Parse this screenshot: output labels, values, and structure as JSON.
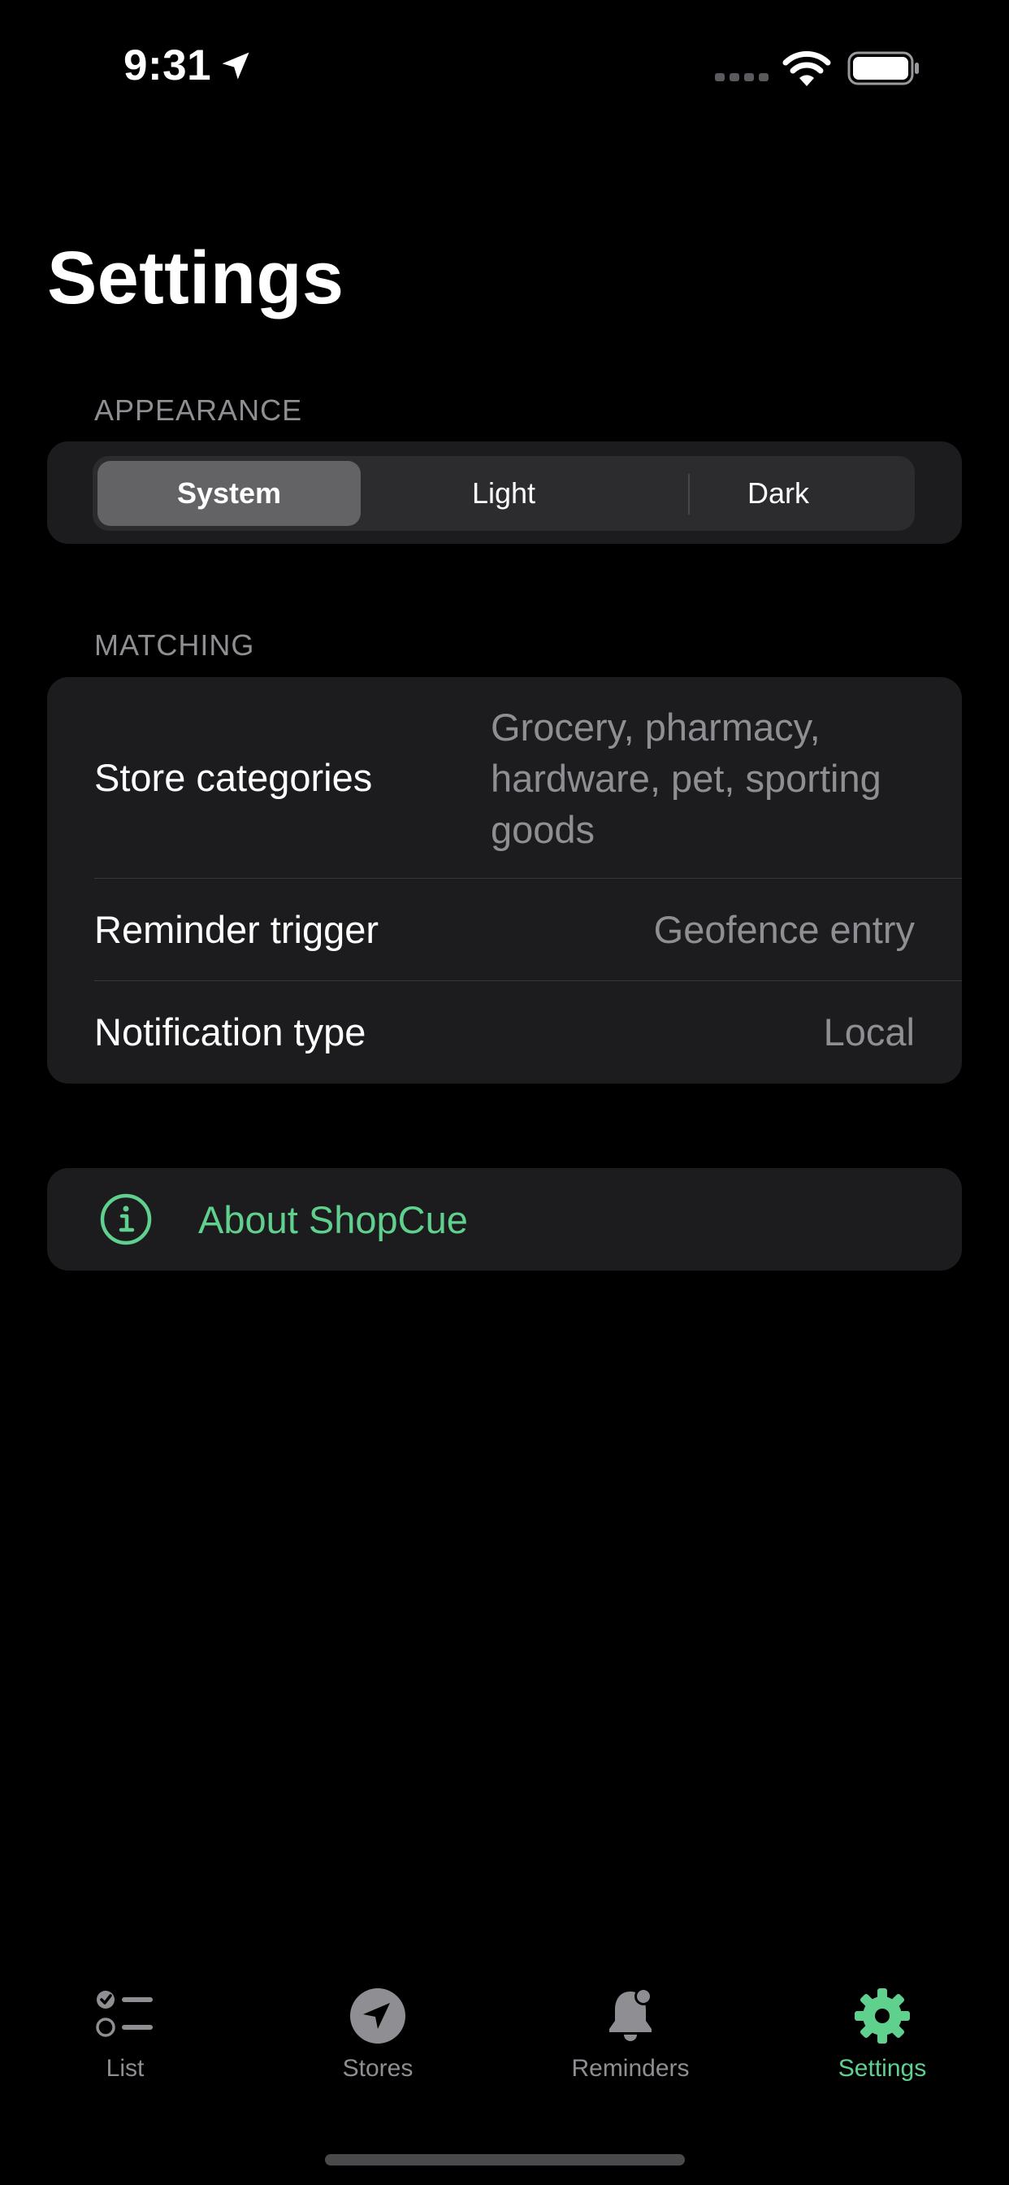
{
  "status_bar": {
    "time": "9:31",
    "icons": [
      "location-arrow-icon",
      "signal-icon",
      "wifi-icon",
      "battery-icon"
    ]
  },
  "title": "Settings",
  "appearance": {
    "header": "APPEARANCE",
    "segments": [
      "System",
      "Light",
      "Dark"
    ],
    "selected": "System"
  },
  "matching": {
    "header": "MATCHING",
    "rows": [
      {
        "label": "Store categories",
        "value": "Grocery, pharmacy, hardware, pet, sporting goods"
      },
      {
        "label": "Reminder trigger",
        "value": "Geofence entry"
      },
      {
        "label": "Notification type",
        "value": "Local"
      }
    ]
  },
  "about": {
    "label": "About ShopCue",
    "icon": "info-circle-icon"
  },
  "tab_bar": {
    "tabs": [
      {
        "label": "List",
        "icon": "checklist-icon",
        "active": false
      },
      {
        "label": "Stores",
        "icon": "location-arrow-circle-icon",
        "active": false
      },
      {
        "label": "Reminders",
        "icon": "bell-badge-icon",
        "active": false
      },
      {
        "label": "Settings",
        "icon": "gear-icon",
        "active": true
      }
    ]
  },
  "colors": {
    "background": "#000000",
    "card": "#1c1c1e",
    "accent": "#5fd08d",
    "secondary_text": "#8e8e93",
    "segment_selected": "#636366"
  }
}
